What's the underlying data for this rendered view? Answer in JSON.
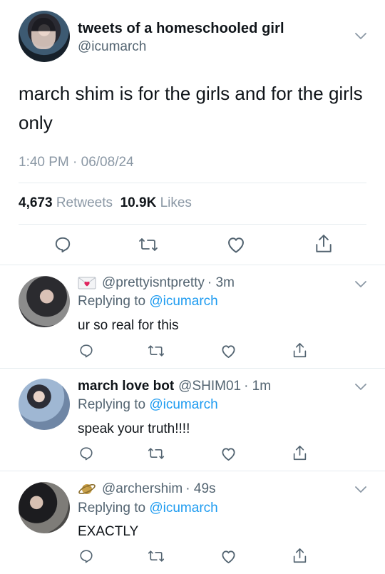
{
  "main_tweet": {
    "display_name": "tweets of a homeschooled girl",
    "handle": "@icumarch",
    "text": "march shim is for the girls and for the girls only",
    "timestamp": "1:40 PM · 06/08/24",
    "retweets_count": "4,673",
    "retweets_label": "Retweets",
    "likes_count": "10.9K",
    "likes_label": "Likes",
    "avatar_icon": "profile-photo",
    "actions": [
      "reply-icon",
      "retweet-icon",
      "like-icon",
      "share-icon"
    ]
  },
  "replies": [
    {
      "display_name": "",
      "emoji": "love-letter-emoji",
      "handle": "@prettyisntpretty",
      "time": "· 3m",
      "replying_prefix": "Replying to",
      "replying_to": "@icumarch",
      "text": "ur so real for this"
    },
    {
      "display_name": "march love bot",
      "emoji": "",
      "handle": "@SHIM01",
      "time": "· 1m",
      "replying_prefix": "Replying to",
      "replying_to": "@icumarch",
      "text": "speak your truth!!!!"
    },
    {
      "display_name": "",
      "emoji": "ringed-planet-emoji",
      "handle": "@archershim",
      "time": "· 49s",
      "replying_prefix": "Replying to",
      "replying_to": "@icumarch",
      "text": "EXACTLY"
    }
  ],
  "colors": {
    "text": "#0f1419",
    "secondary": "#536471",
    "muted": "#8b98a5",
    "link": "#1d9bf0",
    "divider": "#e6ecf0",
    "icon": "#536471"
  }
}
